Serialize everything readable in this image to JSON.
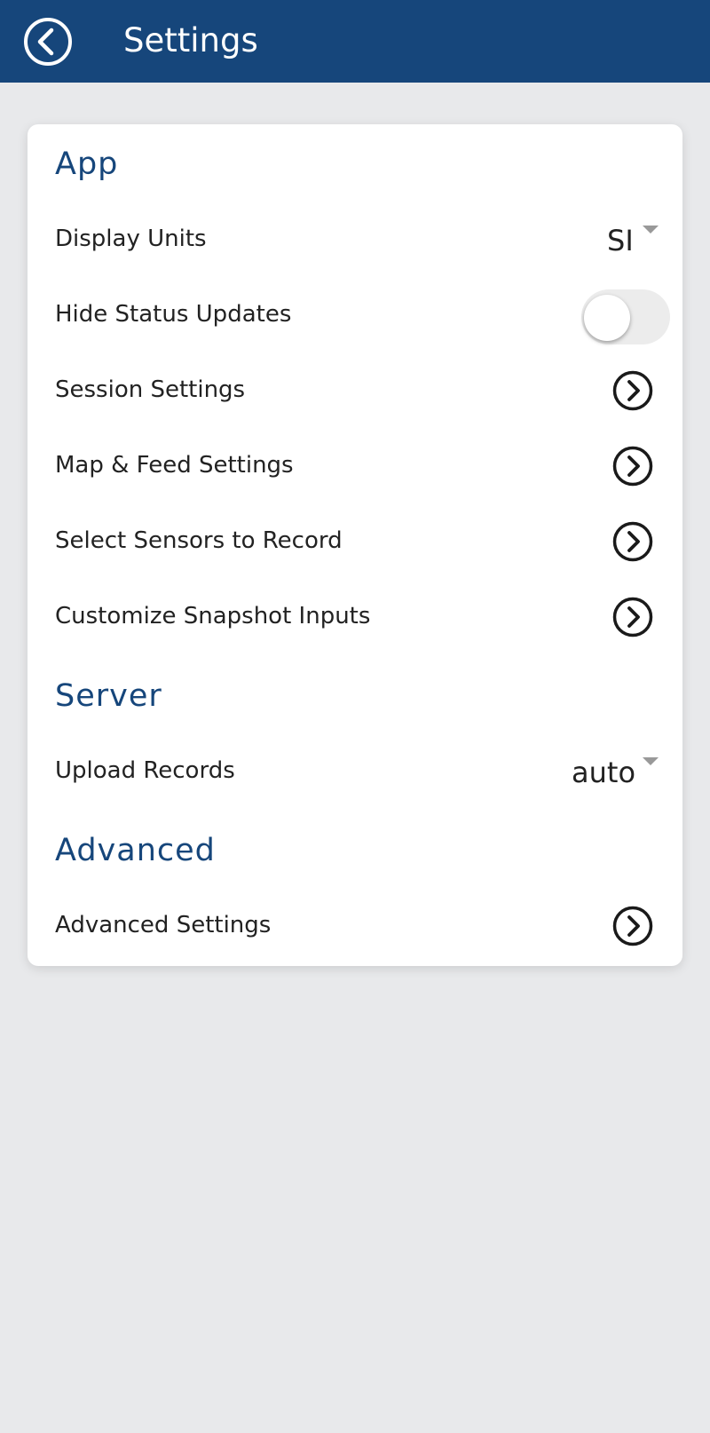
{
  "header": {
    "title": "Settings",
    "back_icon": "back-circle-icon",
    "background": "#16467b"
  },
  "sections": {
    "app": {
      "title": "App",
      "display_units": {
        "label": "Display Units",
        "value": "SI"
      },
      "hide_status_updates": {
        "label": "Hide Status Updates",
        "enabled": false
      },
      "session_settings": {
        "label": "Session Settings"
      },
      "map_feed_settings": {
        "label": "Map & Feed Settings"
      },
      "select_sensors": {
        "label": "Select Sensors to Record"
      },
      "customize_snapshot": {
        "label": "Customize Snapshot Inputs"
      }
    },
    "server": {
      "title": "Server",
      "upload_records": {
        "label": "Upload Records",
        "value": "auto"
      }
    },
    "advanced": {
      "title": "Advanced",
      "advanced_settings": {
        "label": "Advanced Settings"
      }
    }
  },
  "icons": {
    "row_chevron": "chevron-right-circle-icon",
    "dropdown": "caret-down-icon"
  },
  "colors": {
    "accent": "#16467b",
    "background": "#e8e9eb",
    "card": "#ffffff"
  }
}
